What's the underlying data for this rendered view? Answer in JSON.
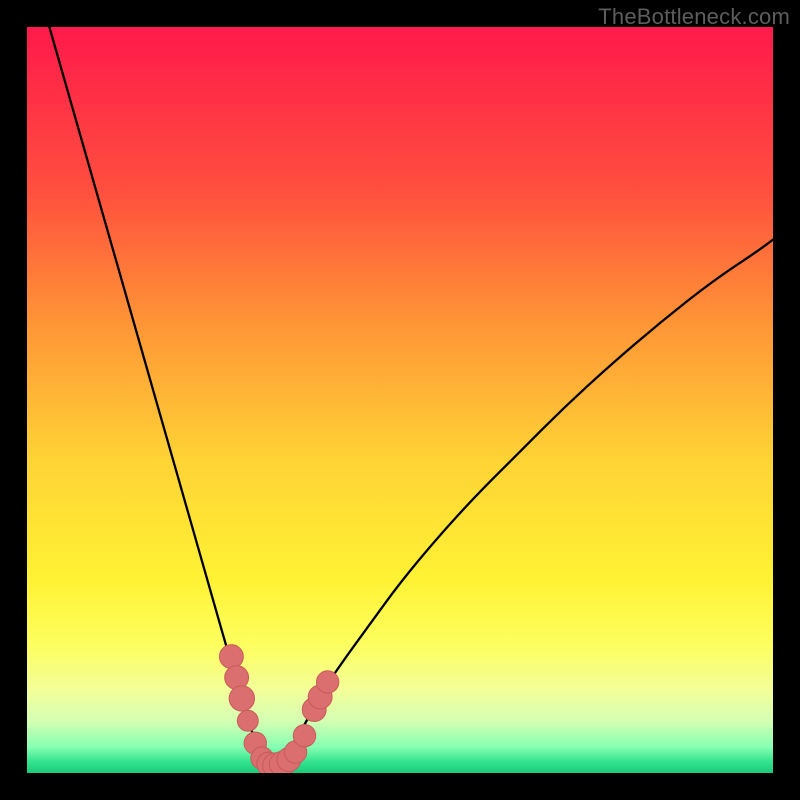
{
  "watermark": "TheBottleneck.com",
  "chart_data": {
    "type": "line",
    "title": "",
    "xlabel": "",
    "ylabel": "",
    "xlim": [
      0,
      100
    ],
    "ylim": [
      0,
      100
    ],
    "grid": false,
    "legend": false,
    "annotations": [],
    "gradient_stops": [
      {
        "offset": 0.0,
        "color": "#ff1a4b"
      },
      {
        "offset": 0.22,
        "color": "#ff4f3e"
      },
      {
        "offset": 0.4,
        "color": "#ff9636"
      },
      {
        "offset": 0.58,
        "color": "#ffd335"
      },
      {
        "offset": 0.74,
        "color": "#fff234"
      },
      {
        "offset": 0.83,
        "color": "#fdff60"
      },
      {
        "offset": 0.89,
        "color": "#f3ff9a"
      },
      {
        "offset": 0.93,
        "color": "#d5ffb3"
      },
      {
        "offset": 0.965,
        "color": "#87ffb2"
      },
      {
        "offset": 0.985,
        "color": "#33e38e"
      },
      {
        "offset": 1.0,
        "color": "#1acb7a"
      }
    ],
    "series": [
      {
        "name": "bottleneck-curve",
        "x": [
          3,
          5,
          7,
          9,
          11,
          13,
          15,
          17,
          19,
          21,
          23,
          25,
          27,
          28.5,
          30,
          31,
          32,
          33,
          34,
          35,
          37,
          39,
          42,
          46,
          50,
          55,
          60,
          66,
          72,
          78,
          85,
          92,
          98,
          100
        ],
        "y": [
          100,
          93,
          86,
          79,
          72,
          65,
          58,
          51,
          44,
          37,
          30,
          23,
          16,
          11,
          6,
          3,
          1.5,
          1,
          1.5,
          3,
          6,
          10,
          14.5,
          20,
          25.5,
          31.5,
          37,
          43,
          49,
          54.5,
          60.5,
          66,
          70,
          71.5
        ]
      }
    ],
    "markers": {
      "name": "highlighted-points",
      "color": "#db6e6e",
      "outline": "#c95a5a",
      "points": [
        {
          "x": 27.4,
          "y": 15.6,
          "r": 1.6
        },
        {
          "x": 28.1,
          "y": 12.8,
          "r": 1.6
        },
        {
          "x": 28.8,
          "y": 10.0,
          "r": 1.7
        },
        {
          "x": 29.6,
          "y": 7.0,
          "r": 1.4
        },
        {
          "x": 30.6,
          "y": 4.0,
          "r": 1.5
        },
        {
          "x": 31.5,
          "y": 2.0,
          "r": 1.5
        },
        {
          "x": 32.4,
          "y": 1.2,
          "r": 1.6
        },
        {
          "x": 33.3,
          "y": 1.0,
          "r": 1.7
        },
        {
          "x": 34.2,
          "y": 1.2,
          "r": 1.7
        },
        {
          "x": 35.1,
          "y": 1.8,
          "r": 1.6
        },
        {
          "x": 36.0,
          "y": 2.8,
          "r": 1.5
        },
        {
          "x": 37.2,
          "y": 5.0,
          "r": 1.5
        },
        {
          "x": 38.5,
          "y": 8.5,
          "r": 1.6
        },
        {
          "x": 39.3,
          "y": 10.2,
          "r": 1.6
        },
        {
          "x": 40.3,
          "y": 12.2,
          "r": 1.5
        }
      ]
    }
  }
}
